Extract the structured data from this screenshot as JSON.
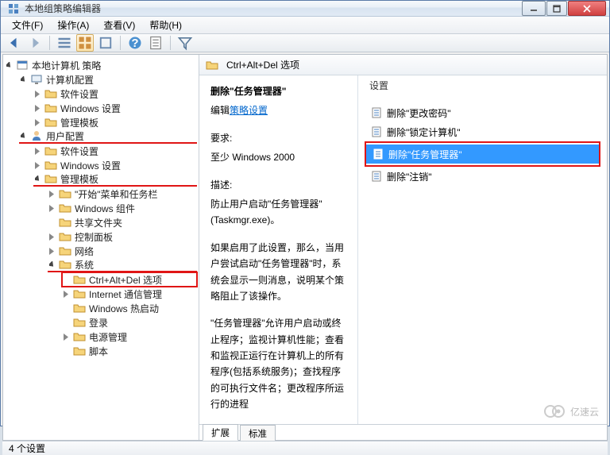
{
  "window": {
    "title": "本地组策略编辑器"
  },
  "menu": {
    "file": "文件(F)",
    "action": "操作(A)",
    "view": "查看(V)",
    "help": "帮助(H)"
  },
  "tree": {
    "root": "本地计算机 策略",
    "computer": "计算机配置",
    "c_software": "软件设置",
    "c_windows": "Windows 设置",
    "c_admin": "管理模板",
    "user": "用户配置",
    "u_software": "软件设置",
    "u_windows": "Windows 设置",
    "u_admin": "管理模板",
    "start_taskbar": "\"开始\"菜单和任务栏",
    "win_components": "Windows 组件",
    "shared_folders": "共享文件夹",
    "control_panel": "控制面板",
    "network": "网络",
    "system": "系统",
    "ctrlaltdel": "Ctrl+Alt+Del 选项",
    "internet": "Internet 通信管理",
    "win_fastboot": "Windows 热启动",
    "login": "登录",
    "power": "电源管理",
    "script": "脚本"
  },
  "header": {
    "title": "Ctrl+Alt+Del 选项"
  },
  "desc": {
    "title": "删除\"任务管理器\"",
    "edit_label": "编辑",
    "edit_link": "策略设置",
    "req_label": "要求:",
    "req_value": "至少 Windows 2000",
    "desc_label": "描述:",
    "desc_line1": "防止用户启动\"任务管理器\"(Taskmgr.exe)。",
    "desc_line2": "如果启用了此设置，那么，当用户尝试启动\"任务管理器\"时，系统会显示一则消息，说明某个策略阻止了该操作。",
    "desc_line3": "\"任务管理器\"允许用户启动或终止程序；监视计算机性能；查看和监视正运行在计算机上的所有程序(包括系统服务)；查找程序的可执行文件名；更改程序所运行的进程"
  },
  "list": {
    "header": "设置",
    "items": [
      "删除\"更改密码\"",
      "删除\"锁定计算机\"",
      "删除\"任务管理器\"",
      "删除\"注销\""
    ]
  },
  "tabs": {
    "extended": "扩展",
    "standard": "标准"
  },
  "status": "4 个设置",
  "watermark": "亿速云"
}
